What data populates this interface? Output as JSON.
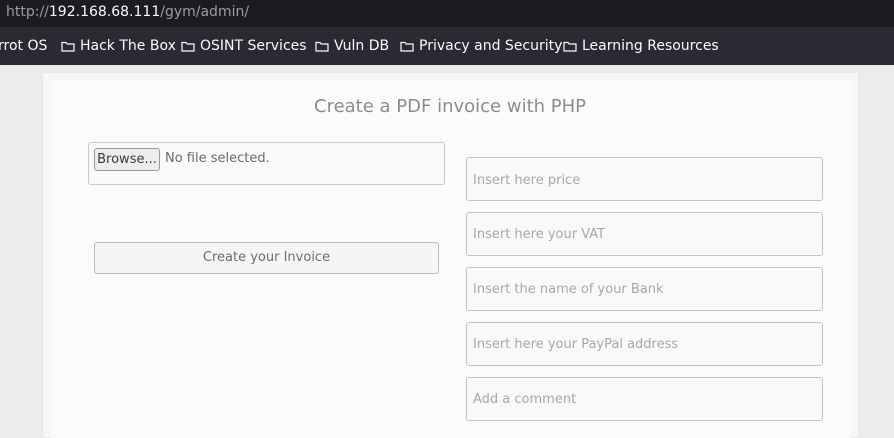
{
  "browser": {
    "url_prefix": "http://",
    "url_host": "192.168.68.111",
    "url_path": "/gym/admin/"
  },
  "bookmarks": [
    {
      "label": "rrot OS",
      "icon": "none"
    },
    {
      "label": "Hack The Box",
      "icon": "folder-icon"
    },
    {
      "label": "OSINT Services",
      "icon": "folder-icon"
    },
    {
      "label": "Vuln DB",
      "icon": "folder-icon"
    },
    {
      "label": "Privacy and Security",
      "icon": "folder-icon"
    },
    {
      "label": "Learning Resources",
      "icon": "folder-icon"
    }
  ],
  "form": {
    "title": "Create a PDF invoice with PHP",
    "browse_label": "Browse...",
    "file_status": "No file selected.",
    "create_label": "Create your Invoice",
    "price_placeholder": "Insert here price",
    "vat_placeholder": "Insert here your VAT",
    "bank_placeholder": "Insert the name of your Bank",
    "paypal_placeholder": "Insert here your PayPal address",
    "comment_placeholder": "Add a comment"
  }
}
